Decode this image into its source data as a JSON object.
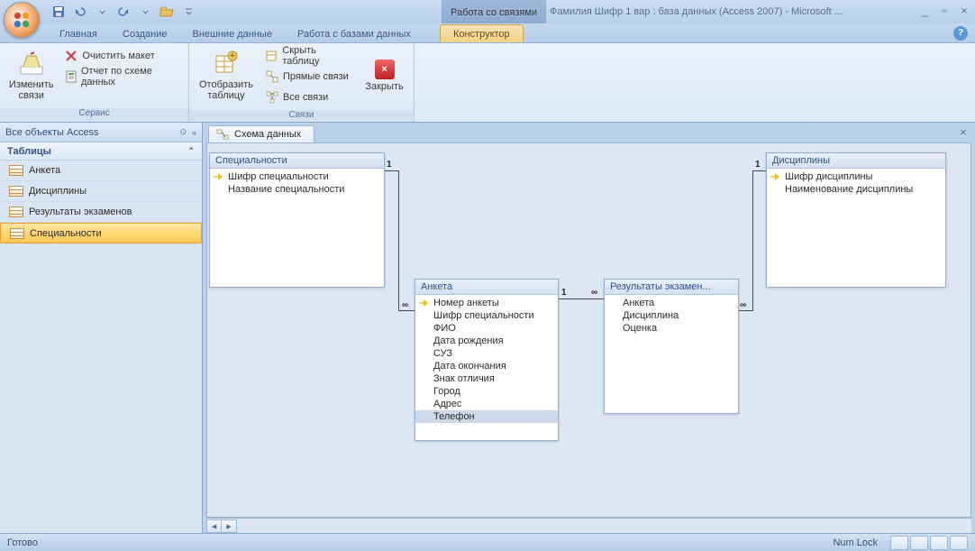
{
  "titlebar": {
    "context_title": "Работа со связями",
    "app_title": "Фамилия Шифр 1 вар : база данных (Access 2007) - Microsoft ..."
  },
  "tabs": {
    "home": "Главная",
    "create": "Создание",
    "external": "Внешние данные",
    "dbtools": "Работа с базами данных",
    "designer": "Конструктор"
  },
  "ribbon": {
    "group_service": "Сервис",
    "group_links": "Связи",
    "edit_links": "Изменить\nсвязи",
    "clear_layout": "Очистить макет",
    "schema_report": "Отчет по схеме данных",
    "show_table": "Отобразить\nтаблицу",
    "hide_table": "Скрыть таблицу",
    "direct_links": "Прямые связи",
    "all_links": "Все связи",
    "close": "Закрыть"
  },
  "navpane": {
    "header": "Все объекты Access",
    "group_tables": "Таблицы",
    "items": [
      "Анкета",
      "Дисциплины",
      "Результаты экзаменов",
      "Специальности"
    ],
    "selected": "Специальности"
  },
  "doctab": {
    "label": "Схема данных"
  },
  "tables": {
    "spec": {
      "title": "Специальности",
      "fields": [
        "Шифр специальности",
        "Название специальности"
      ],
      "keys": [
        0
      ]
    },
    "anketa": {
      "title": "Анкета",
      "fields": [
        "Номер анкеты",
        "Шифр специальности",
        "ФИО",
        "Дата рождения",
        "СУЗ",
        "Дата окончания",
        "Знак отличия",
        "Город",
        "Адрес",
        "Телефон"
      ],
      "keys": [
        0
      ],
      "selected": 9
    },
    "results": {
      "title": "Результаты экзамен...",
      "fields": [
        "Анкета",
        "Дисциплина",
        "Оценка"
      ],
      "keys": []
    },
    "disc": {
      "title": "Дисциплины",
      "fields": [
        "Шифр дисциплины",
        "Наименование дисциплины"
      ],
      "keys": [
        0
      ]
    }
  },
  "statusbar": {
    "ready": "Готово",
    "numlock": "Num Lock"
  }
}
